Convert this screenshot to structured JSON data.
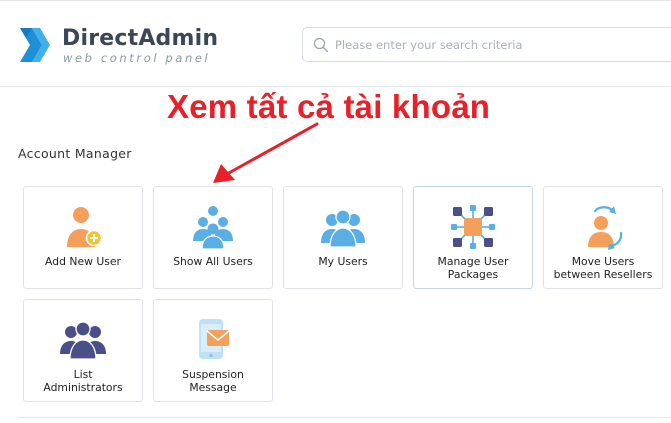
{
  "app": {
    "name": "DirectAdmin",
    "tagline": "web control panel"
  },
  "search": {
    "placeholder": "Please enter your search criteria",
    "value": ""
  },
  "annotation": {
    "text": "Xem tất cả tài khoản",
    "color": "#e8202a"
  },
  "section": {
    "title": "Account Manager"
  },
  "tiles": [
    {
      "id": "add-new-user",
      "label": "Add New User",
      "icon": "user-plus-icon"
    },
    {
      "id": "show-all-users",
      "label": "Show All Users",
      "icon": "users-group-icon"
    },
    {
      "id": "my-users",
      "label": "My Users",
      "icon": "users-icon"
    },
    {
      "id": "manage-user-packages",
      "label_line1": "Manage User",
      "label_line2": "Packages",
      "icon": "packages-network-icon"
    },
    {
      "id": "move-users",
      "label_line1": "Move Users",
      "label_line2": "between Resellers",
      "icon": "user-move-icon"
    },
    {
      "id": "list-administrators",
      "label_line1": "List",
      "label_line2": "Administrators",
      "icon": "admins-group-icon"
    },
    {
      "id": "suspension-message",
      "label_line1": "Suspension",
      "label_line2": "Message",
      "icon": "phone-message-icon"
    }
  ],
  "colors": {
    "accent_blue": "#5aaee6",
    "orange": "#f5a05a",
    "navy": "#4a4f87",
    "logo_blue": "#1f8fd6"
  }
}
